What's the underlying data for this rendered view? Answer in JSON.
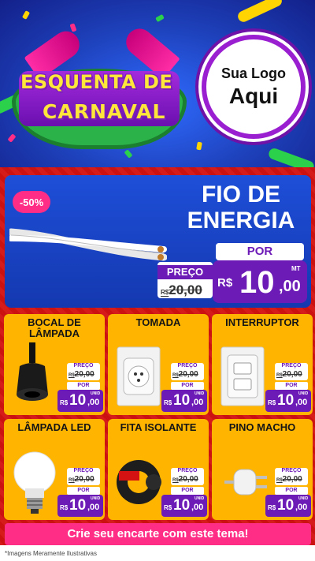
{
  "header": {
    "title_line1": "ESQUENTA DE",
    "title_line2": "CARNAVAL",
    "logo_line1": "Sua Logo",
    "logo_line2": "Aqui"
  },
  "feature": {
    "discount": "-50%",
    "name": "FIO DE ENERGIA",
    "old_label": "PREÇO",
    "old_currency": "R$",
    "old_value": "20,00",
    "por_label": "POR",
    "new_currency": "R$",
    "new_int": "10",
    "new_dec": ",00",
    "unit": "MT"
  },
  "products": [
    {
      "name": "BOCAL DE LÂMPADA",
      "old_label": "PREÇO",
      "old_value": "20,00",
      "por_label": "POR",
      "currency": "R$",
      "int": "10",
      "dec": ",00",
      "unit": "UNID",
      "icon": "socket-icon"
    },
    {
      "name": "TOMADA",
      "old_label": "PREÇO",
      "old_value": "20,00",
      "por_label": "POR",
      "currency": "R$",
      "int": "10",
      "dec": ",00",
      "unit": "UNID",
      "icon": "outlet-icon"
    },
    {
      "name": "INTERRUPTOR",
      "old_label": "PREÇO",
      "old_value": "20,00",
      "por_label": "POR",
      "currency": "R$",
      "int": "10",
      "dec": ",00",
      "unit": "UNID",
      "icon": "switch-icon"
    },
    {
      "name": "LÂMPADA LED",
      "old_label": "PREÇO",
      "old_value": "20,00",
      "por_label": "POR",
      "currency": "R$",
      "int": "10",
      "dec": ",00",
      "unit": "UNID",
      "icon": "bulb-icon"
    },
    {
      "name": "FITA ISOLANTE",
      "old_label": "PREÇO",
      "old_value": "20,00",
      "por_label": "POR",
      "currency": "R$",
      "int": "10",
      "dec": ",00",
      "unit": "UNID",
      "icon": "tape-icon"
    },
    {
      "name": "PINO MACHO",
      "old_label": "PREÇO",
      "old_value": "20,00",
      "por_label": "POR",
      "currency": "R$",
      "int": "10",
      "dec": ",00",
      "unit": "UNID",
      "icon": "plug-icon"
    }
  ],
  "cta": "Crie seu encarte com este tema!",
  "disclaimer": "*Imagens Meramente Ilustrativas",
  "colors": {
    "accent_purple": "#6d1bb7",
    "background_red": "#d41212",
    "card_yellow": "#ffb400",
    "cta_pink": "#ff2d86",
    "feature_blue": "#1e4fd8"
  }
}
